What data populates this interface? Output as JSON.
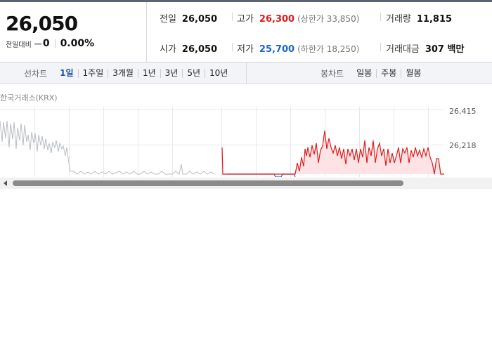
{
  "quote": {
    "price": "26,050",
    "change_label": "전일대비",
    "change_value": "0",
    "change_rate": "0.00%",
    "stats": {
      "prev_close_label": "전일",
      "prev_close": "26,050",
      "open_label": "시가",
      "open": "26,050",
      "high_label": "고가",
      "high": "26,300",
      "upper_limit": "(상한가 33,850)",
      "low_label": "저가",
      "low": "25,700",
      "lower_limit": "(하한가 18,250)",
      "volume_label": "거래량",
      "volume": "11,815",
      "amount_label": "거래대금",
      "amount": "307 백만"
    }
  },
  "tabs": {
    "period_title": "선차트",
    "period": [
      "1일",
      "1주일",
      "3개월",
      "1년",
      "3년",
      "5년",
      "10년"
    ],
    "candle_title": "봉차트",
    "candle": [
      "일봉",
      "주봉",
      "월봉"
    ]
  },
  "chart": {
    "source": "한국거래소(KRX)",
    "y_labels": [
      "26,415",
      "26,218"
    ]
  },
  "colors": {
    "up": "#e01b1b",
    "down": "#1d65c7",
    "active_tab": "#1d4fb0"
  },
  "icons": {
    "flat_change": "flat-dash-icon",
    "scroll_left": "arrow-left-icon"
  }
}
